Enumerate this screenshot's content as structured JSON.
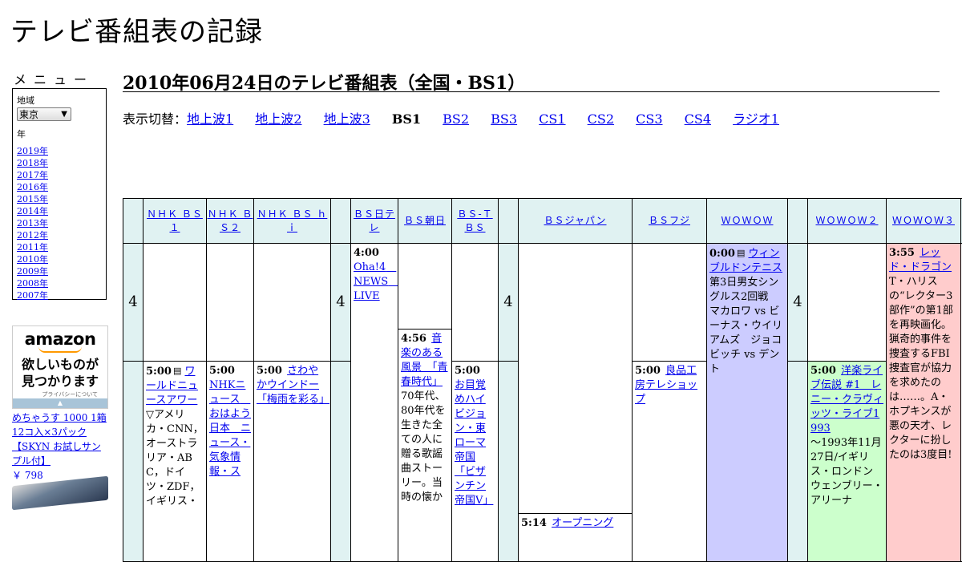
{
  "site": {
    "title": "テレビ番組表の記録"
  },
  "menu": {
    "title": "メニュー",
    "region_label": "地域",
    "region_value": "東京",
    "year_label": "年",
    "years": [
      "2019年",
      "2018年",
      "2017年",
      "2016年",
      "2015年",
      "2014年",
      "2013年",
      "2012年",
      "2011年",
      "2010年",
      "2009年",
      "2008年",
      "2007年"
    ]
  },
  "ad": {
    "logo": "amazon",
    "copy_line1": "欲しいものが",
    "copy_line2": "見つかります",
    "privacy": "プライバシーについて"
  },
  "product": {
    "name": "めちゃうす 1000 1箱12コ入×3パック【SKYN お試しサンプル付】",
    "price": "￥ 798"
  },
  "page": {
    "heading": "2010年06月24日のテレビ番組表（全国・BS1）",
    "switch_label": "表示切替：",
    "tabs": [
      {
        "label": "地上波1",
        "current": false
      },
      {
        "label": "地上波2",
        "current": false
      },
      {
        "label": "地上波3",
        "current": false
      },
      {
        "label": "BS1",
        "current": true
      },
      {
        "label": "BS2",
        "current": false
      },
      {
        "label": "BS3",
        "current": false
      },
      {
        "label": "CS1",
        "current": false
      },
      {
        "label": "CS2",
        "current": false
      },
      {
        "label": "CS3",
        "current": false
      },
      {
        "label": "CS4",
        "current": false
      },
      {
        "label": "ラジオ1",
        "current": false
      }
    ]
  },
  "schedule": {
    "hour": "4",
    "channels": [
      "ＮＨＫ ＢＳ１",
      "ＮＨＫ ＢＳ２",
      "ＮＨＫ ＢＳ ｈｉ",
      "ＢＳ日テレ",
      "ＢＳ朝日",
      "ＢＳ-ＴＢＳ",
      "ＢＳジャパン",
      "ＢＳフジ",
      "ＷＯＷＯＷ",
      "ＷＯＷＯＷ２",
      "ＷＯＷＯＷ３"
    ],
    "programs": {
      "nhkbs1_0500": {
        "time": "5:00",
        "title": "ワールドニュースアワー",
        "desc": "▽アメリカ・CNN，オーストラリア・ABC，ドイツ・ZDF，イギリス・"
      },
      "nhkbs2_0500": {
        "time": "5:00",
        "title": "NHKニュース　おはよう日本　ニュース・気象情報・ス",
        "desc": ""
      },
      "nhkbshi_0500": {
        "time": "5:00",
        "title": "さわやかウインドー「梅雨を彩る」",
        "desc": ""
      },
      "bsntv_0400": {
        "time": "4:00",
        "title": "Oha!4　NEWS　LIVE",
        "desc": ""
      },
      "bsasahi_0456": {
        "time": "4:56",
        "title": "音楽のある風景　「青春時代」",
        "desc": "70年代、80年代を生きた全ての人に贈る歌謡曲ストーリー。当時の懐か"
      },
      "bstbs_0500": {
        "time": "5:00",
        "title": "お目覚めハイビジョン・東ローマ帝国「ビザンチン帝国V」",
        "desc": ""
      },
      "bsjapan_0514": {
        "time": "5:14",
        "title": "オープニング",
        "desc": ""
      },
      "bsfuji_0500": {
        "time": "5:00",
        "title": "良品工房テレショップ",
        "desc": ""
      },
      "wowow_0000": {
        "time": "0:00",
        "title": "ウィンブルドンテニス",
        "desc": "第3日男女シングルス2回戦　マカロワ vs ビーナス・ウイリアムズ　ジョコビッチ vs デント"
      },
      "wowow2_0500": {
        "time": "5:00",
        "title": "洋楽ライブ伝説 #1　レニー・クラヴィッツ・ライブ1993",
        "desc": "～1993年11月27日/イギリス・ロンドン　ウェンブリー・アリーナ"
      },
      "wowow3_0355": {
        "time": "3:55",
        "title": "レッド・ドラゴン",
        "desc": "T・ハリスの“レクター3部作”の第1部を再映画化。猟奇的事件を捜査するFBI捜査官が協力を求めたのは……。A・ホプキンスが悪の天才、レクターに扮したのは3度目!"
      }
    }
  }
}
